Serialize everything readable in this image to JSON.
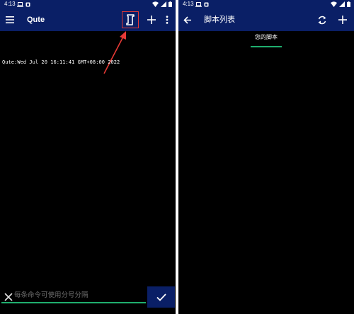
{
  "left_screen": {
    "status_bar": {
      "time": "4:13"
    },
    "app_bar": {
      "title": "Qute"
    },
    "terminal": {
      "output_line": "Qute:Wed Jul 20 16:11:41 GMT+08:00 2022"
    },
    "command_input": {
      "placeholder": "每条命令可使用分号分隔",
      "value": ""
    }
  },
  "right_screen": {
    "status_bar": {
      "time": "4:13"
    },
    "app_bar": {
      "title": "脚本列表"
    },
    "tabs": [
      {
        "label": "您的脚本",
        "selected": true
      }
    ]
  },
  "icons": {
    "menu": "menu-icon",
    "script": "script-icon",
    "add": "add-icon",
    "more": "more-vertical-icon",
    "back": "back-arrow-icon",
    "refresh": "refresh-icon",
    "clear": "close-icon",
    "submit": "check-icon",
    "annotation_arrow": "red-arrow-annotation"
  },
  "colors": {
    "app_bar": "#0a1f66",
    "background": "#000000",
    "accent_green": "#1fae6e",
    "annotation_red": "#e53935",
    "text_primary": "#ffffff",
    "placeholder": "#6f6f6f"
  }
}
